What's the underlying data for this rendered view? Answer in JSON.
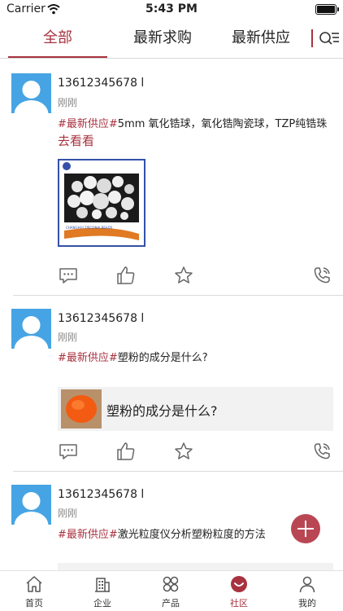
{
  "status_bar": {
    "carrier": "Carrier",
    "time": "5:43 PM"
  },
  "tabs": [
    {
      "label": "全部",
      "active": true
    },
    {
      "label": "最新求购",
      "active": false
    },
    {
      "label": "最新供应",
      "active": false
    }
  ],
  "posts": [
    {
      "username": "13612345678 l",
      "time": "刚刚",
      "tag": "#最新供应#",
      "text": "5mm 氧化锆球，氧化锆陶瓷球，TZP纯锆珠",
      "link": "去看看",
      "image_caption": "CHANGHUI ZIRCONIA BEADS"
    },
    {
      "username": "13612345678 l",
      "time": "刚刚",
      "tag": "#最新供应#",
      "text": "塑粉的成分是什么?",
      "share_title": "塑粉的成分是什么?"
    },
    {
      "username": "13612345678 l",
      "time": "刚刚",
      "tag": "#最新供应#",
      "text": "激光粒度仪分析塑粉粒度的方法"
    }
  ],
  "bottom_nav": [
    {
      "label": "首页",
      "icon": "home-icon"
    },
    {
      "label": "企业",
      "icon": "building-icon"
    },
    {
      "label": "产品",
      "icon": "grid-icon"
    },
    {
      "label": "社区",
      "icon": "community-icon",
      "active": true
    },
    {
      "label": "我的",
      "icon": "user-icon"
    }
  ],
  "colors": {
    "accent": "#a8323f",
    "avatar": "#47a4e4",
    "fab": "#b94753"
  }
}
